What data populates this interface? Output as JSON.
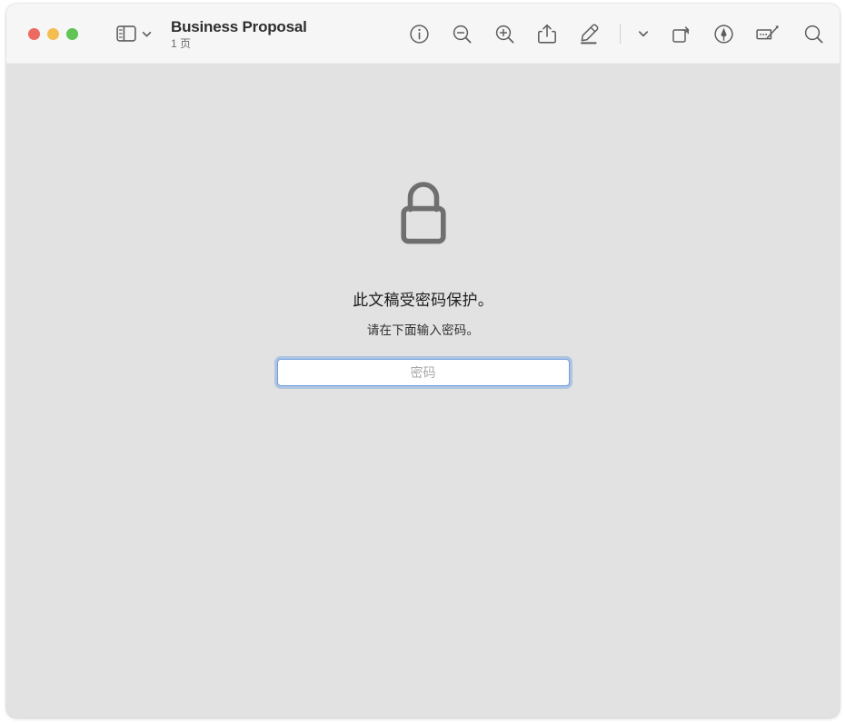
{
  "window": {
    "traffic_lights": [
      {
        "name": "close",
        "color": "#ec6a5f",
        "label": "Close"
      },
      {
        "name": "minimize",
        "color": "#f4bd4f",
        "label": "Minimize"
      },
      {
        "name": "zoom",
        "color": "#61c454",
        "label": "Zoom"
      }
    ]
  },
  "toolbar": {
    "sidebar_toggle_label": "Sidebar",
    "sidebar_chevron_label": "Sidebar options",
    "document_title": "Business Proposal",
    "document_subtitle": "1 页",
    "actions": [
      {
        "name": "info-icon",
        "label": "Info"
      },
      {
        "name": "zoom-out-icon",
        "label": "Zoom Out"
      },
      {
        "name": "zoom-in-icon",
        "label": "Zoom In"
      },
      {
        "name": "share-icon",
        "label": "Share"
      },
      {
        "name": "markup-icon",
        "label": "Markup"
      },
      {
        "name": "markup-options-chevron-icon",
        "label": "Markup Options"
      },
      {
        "name": "rotate-icon",
        "label": "Rotate"
      },
      {
        "name": "annotate-pen-icon",
        "label": "Highlight"
      },
      {
        "name": "sign-icon",
        "label": "Sign"
      },
      {
        "name": "search-icon",
        "label": "Search"
      }
    ]
  },
  "main": {
    "lock_icon_label": "locked-document",
    "message_primary": "此文稿受密码保护。",
    "message_secondary": "请在下面输入密码。",
    "password_placeholder": "密码",
    "password_value": ""
  },
  "colors": {
    "toolbar_bg": "#f6f6f6",
    "content_bg": "#e2e2e2",
    "icon": "#5e5e5e",
    "lock": "#6f6f6f",
    "focus_ring": "#6e9fe0",
    "title_text": "#2f2f2f",
    "subtitle_text": "#6d6d6d"
  }
}
